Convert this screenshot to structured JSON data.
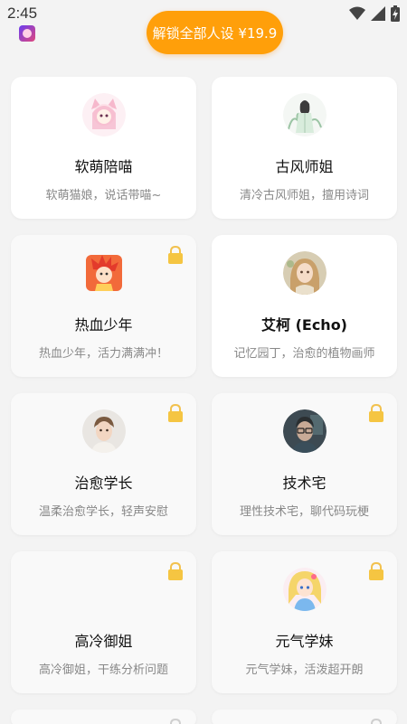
{
  "status_bar": {
    "time": "2:45",
    "icons": [
      "wifi-icon",
      "signal-icon",
      "battery-icon"
    ]
  },
  "unlock_button": {
    "label": "解锁全部人设 ¥19.9"
  },
  "colors": {
    "accent": "#ff9f0a",
    "lock": "#f5c542",
    "bg": "#f3f3f3"
  },
  "personas": [
    {
      "name": "软萌陪喵",
      "desc": "软萌猫娘，说话带喵~",
      "locked": false,
      "avatar": "cat-girl-avatar"
    },
    {
      "name": "古风师姐",
      "desc": "清冷古风师姐，擅用诗词",
      "locked": false,
      "avatar": "ancient-style-avatar"
    },
    {
      "name": "热血少年",
      "desc": "热血少年，活力满满冲！",
      "locked": true,
      "avatar": "hot-blooded-boy-avatar"
    },
    {
      "name": "艾柯 (Echo)",
      "desc": "记忆园丁，治愈的植物画师",
      "locked": false,
      "avatar": "echo-avatar"
    },
    {
      "name": "治愈学长",
      "desc": "温柔治愈学长，轻声安慰",
      "locked": true,
      "avatar": "gentle-senior-avatar"
    },
    {
      "name": "技术宅",
      "desc": "理性技术宅，聊代码玩梗",
      "locked": true,
      "avatar": "tech-geek-avatar"
    },
    {
      "name": "高冷御姐",
      "desc": "高冷御姐，干练分析问题",
      "locked": true,
      "avatar": ""
    },
    {
      "name": "元气学妹",
      "desc": "元气学妹，活泼超开朗",
      "locked": true,
      "avatar": "energetic-junior-avatar"
    }
  ]
}
